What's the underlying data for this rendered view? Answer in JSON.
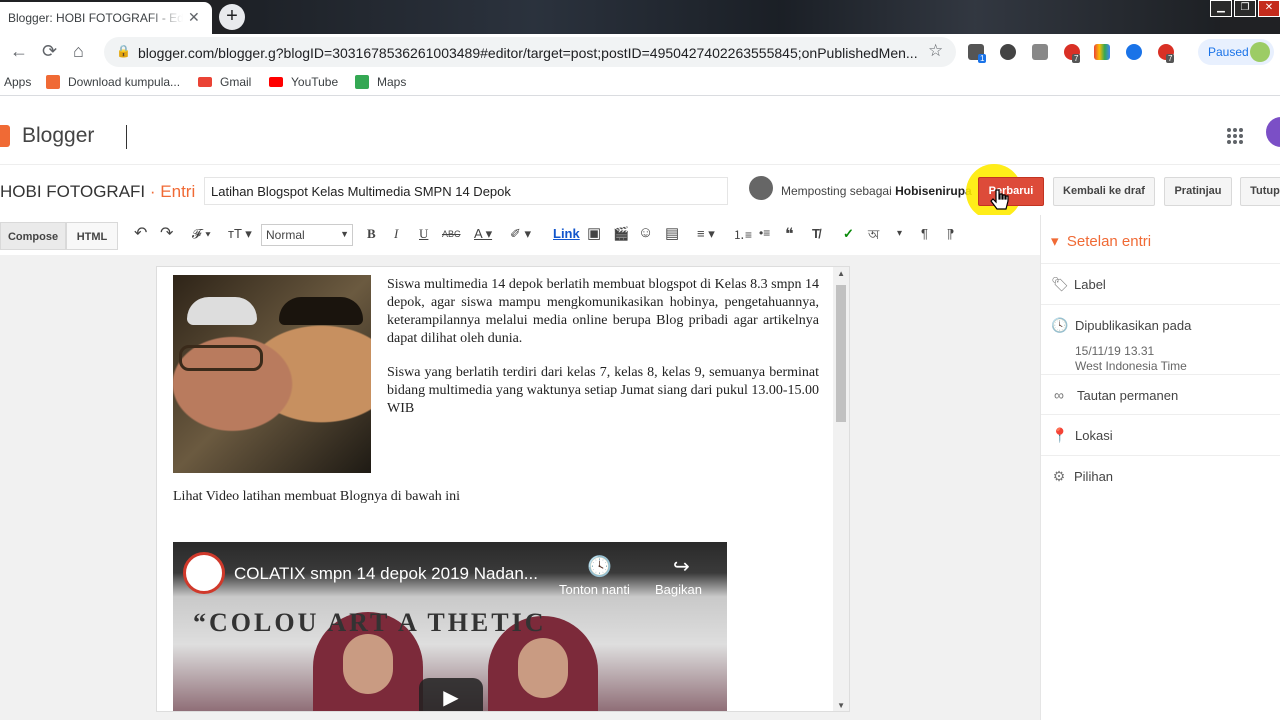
{
  "browser": {
    "tab_title": "Blogger: HOBI FOTOGRAFI - Edit",
    "tab_close": "✕",
    "new_tab": "+",
    "url": "blogger.com/blogger.g?blogID=3031678536261003489#editor/target=post;postID=4950427402263555845;onPublishedMen...",
    "back": "←",
    "forward": "→",
    "reload": "⟳",
    "home": "⌂",
    "lock": "🔒",
    "star": "☆",
    "ext_badges": [
      "1",
      "7",
      "7"
    ],
    "profile_status": "Paused",
    "win_controls": [
      "▁",
      "❐",
      "✕"
    ]
  },
  "bookmarks": [
    {
      "label": "Apps",
      "icon": "apps-grid-icon",
      "color": "#4285f4"
    },
    {
      "label": "Download kumpula...",
      "icon": "blogger-icon",
      "color": "#f06a35"
    },
    {
      "label": "Gmail",
      "icon": "gmail-icon",
      "color": "#ea4335"
    },
    {
      "label": "YouTube",
      "icon": "youtube-icon",
      "color": "#ff0000"
    },
    {
      "label": "Maps",
      "icon": "maps-icon",
      "color": "#34a853"
    }
  ],
  "blogger": {
    "brand": "Blogger",
    "apps_icon": "⋮⋮⋮",
    "blog_name": "HOBI FOTOGRAFI",
    "separator": "·",
    "section": "Entri",
    "post_title": "Latihan Blogspot Kelas Multimedia SMPN 14 Depok",
    "posting_as_prefix": "Memposting sebagai",
    "posting_as_user": "Hobisenirupa",
    "buttons": {
      "update": "Perbarui",
      "revert": "Kembali ke draf",
      "preview": "Pratinjau",
      "close": "Tutup"
    },
    "accent": "#f06a35"
  },
  "editor_toolbar": {
    "compose": "Compose",
    "html": "HTML",
    "undo": "↶",
    "redo": "↷",
    "font": "𝓕 ▾",
    "font_size": "ᴛT ▾",
    "format": "Normal",
    "bold": "B",
    "italic": "I",
    "underline": "U",
    "strike": "ABC",
    "text_color": "A ▾",
    "highlight": "✐ ▾",
    "link": "Link",
    "image": "▣",
    "video": "🎬",
    "emoji": "☺",
    "jump": "▤",
    "align": "≡ ▾",
    "numbered_list": "⒈≡",
    "bullet_list": "•≡",
    "quote": "❝",
    "clear": "T̸",
    "spell": "✓",
    "translit": "অ",
    "more": "▾",
    "ltr": "¶",
    "rtl": "¶"
  },
  "post": {
    "paragraph1": "Siswa multimedia 14 depok berlatih membuat blogspot di Kelas 8.3 smpn 14 depok, agar siswa mampu mengkomunikasikan hobinya, pengetahuannya, keterampilannya melalui media online berupa Blog pribadi agar artikelnya  dapat dilihat oleh dunia.",
    "paragraph2": "Siswa yang berlatih terdiri dari kelas 7, kelas 8, kelas 9, semuanya berminat bidang multimedia yang waktunya setiap Jumat siang dari pukul 13.00-15.00 WIB",
    "caption": "Lihat Video latihan membuat Blognya di bawah ini",
    "video": {
      "title": "COLATIX smpn 14 depok 2019 Nadan...",
      "watch_later": "Tonton nanti",
      "share": "Bagikan",
      "banner": "“COLOU  ART A   THETIC",
      "clock_icon": "🕓",
      "share_icon": "↪",
      "play": "▶"
    }
  },
  "settings": {
    "header_arrow": "▾",
    "header": "Setelan entri",
    "rows": [
      {
        "label": "Label",
        "icon": "label-icon",
        "glyph": "🏷"
      },
      {
        "label": "Dipublikasikan pada",
        "icon": "clock-icon",
        "glyph": "🕓"
      },
      {
        "label": "Tautan permanen",
        "icon": "link-icon",
        "glyph": "∞"
      },
      {
        "label": "Lokasi",
        "icon": "location-icon",
        "glyph": "📍"
      },
      {
        "label": "Pilihan",
        "icon": "gear-icon",
        "glyph": "⚙"
      }
    ],
    "published_date": "15/11/19 13.31",
    "published_tz": "West Indonesia Time"
  }
}
